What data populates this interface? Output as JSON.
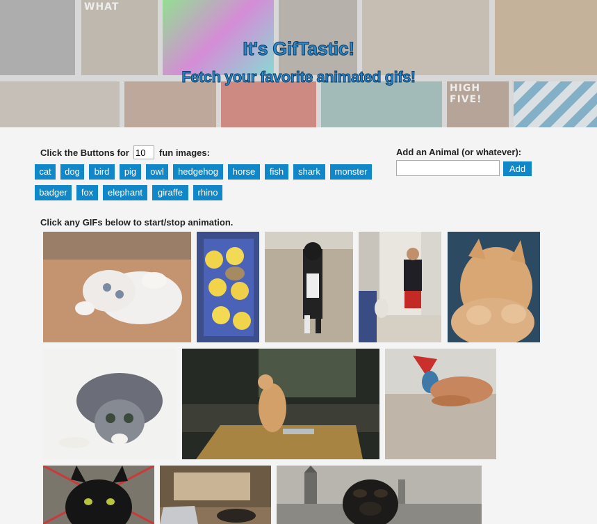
{
  "banner": {
    "title": "It's GifTastic!",
    "subtitle": "Fetch your favorite animated gifs!",
    "tile_texts": [
      "WHAT",
      "HIGH FIVE!"
    ]
  },
  "controls": {
    "click_label": "Click the Buttons for",
    "count_value": "10",
    "fun_label": "fun images:",
    "animals": [
      "cat",
      "dog",
      "bird",
      "pig",
      "owl",
      "hedgehog",
      "horse",
      "fish",
      "shark",
      "monster",
      "badger",
      "fox",
      "elephant",
      "giraffe",
      "rhino"
    ]
  },
  "add_animal": {
    "label": "Add an Animal (or whatever):",
    "input_value": "",
    "button_label": "Add"
  },
  "gifs": {
    "instructions": "Click any GIFs below to start/stop animation.",
    "items": [
      {
        "subject": "white kitten rolling on floor"
      },
      {
        "subject": "kitten in basket of yellow chicks"
      },
      {
        "subject": "cat standing on hind legs on beach"
      },
      {
        "subject": "man walking with cat in hallway"
      },
      {
        "subject": "orange tabby kitten with paws up"
      },
      {
        "subject": "tabby cat crouching to pounce"
      },
      {
        "subject": "orange cat standing on kitchen table"
      },
      {
        "subject": "cat paw on carpet near wall art"
      },
      {
        "subject": "black cat close-up"
      },
      {
        "subject": "cat on desk with laptop"
      },
      {
        "subject": "dog over city skyline"
      }
    ]
  },
  "colors": {
    "accent": "#0f87c9",
    "title_fill": "#2d88c9",
    "title_stroke": "#0b3c66",
    "background": "#f4f4f4"
  }
}
